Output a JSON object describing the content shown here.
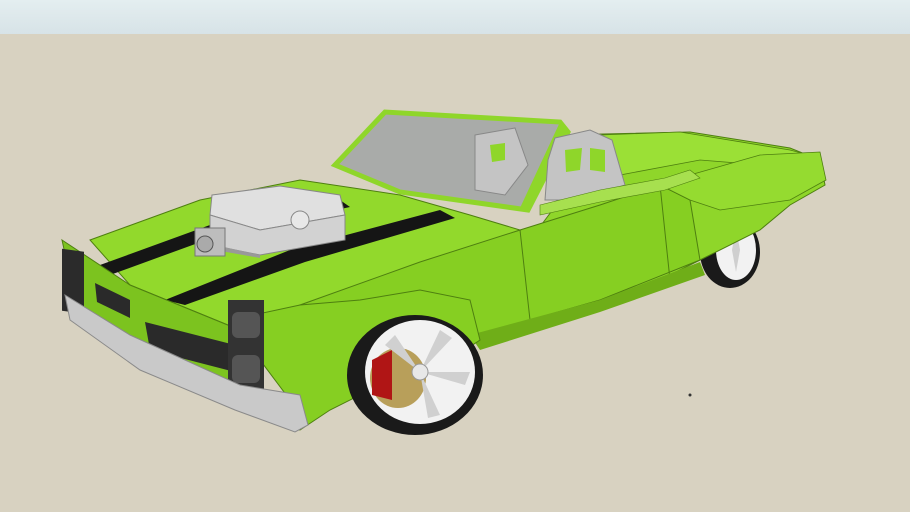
{
  "scene": {
    "colors": {
      "sky": "#dfe9ec",
      "ground": "#d8d2c1",
      "body": "#8fd62a",
      "body_shade": "#78bd1c",
      "body_dark": "#5f9a12",
      "stripe": "#151515",
      "chrome": "#c9c9c9",
      "tire": "#1a1a1a",
      "rim": "#f2f2f2",
      "brake_caliper": "#b01515",
      "rotor": "#b89f5a",
      "glass": "#a9aba9",
      "seat": "#c4c4c4"
    },
    "model": {
      "subject": "green-convertible-car-icon",
      "features": [
        "hood-stripes",
        "supercharger",
        "bucket-seats",
        "windshield",
        "chrome-bumper",
        "custom-rims"
      ]
    }
  }
}
